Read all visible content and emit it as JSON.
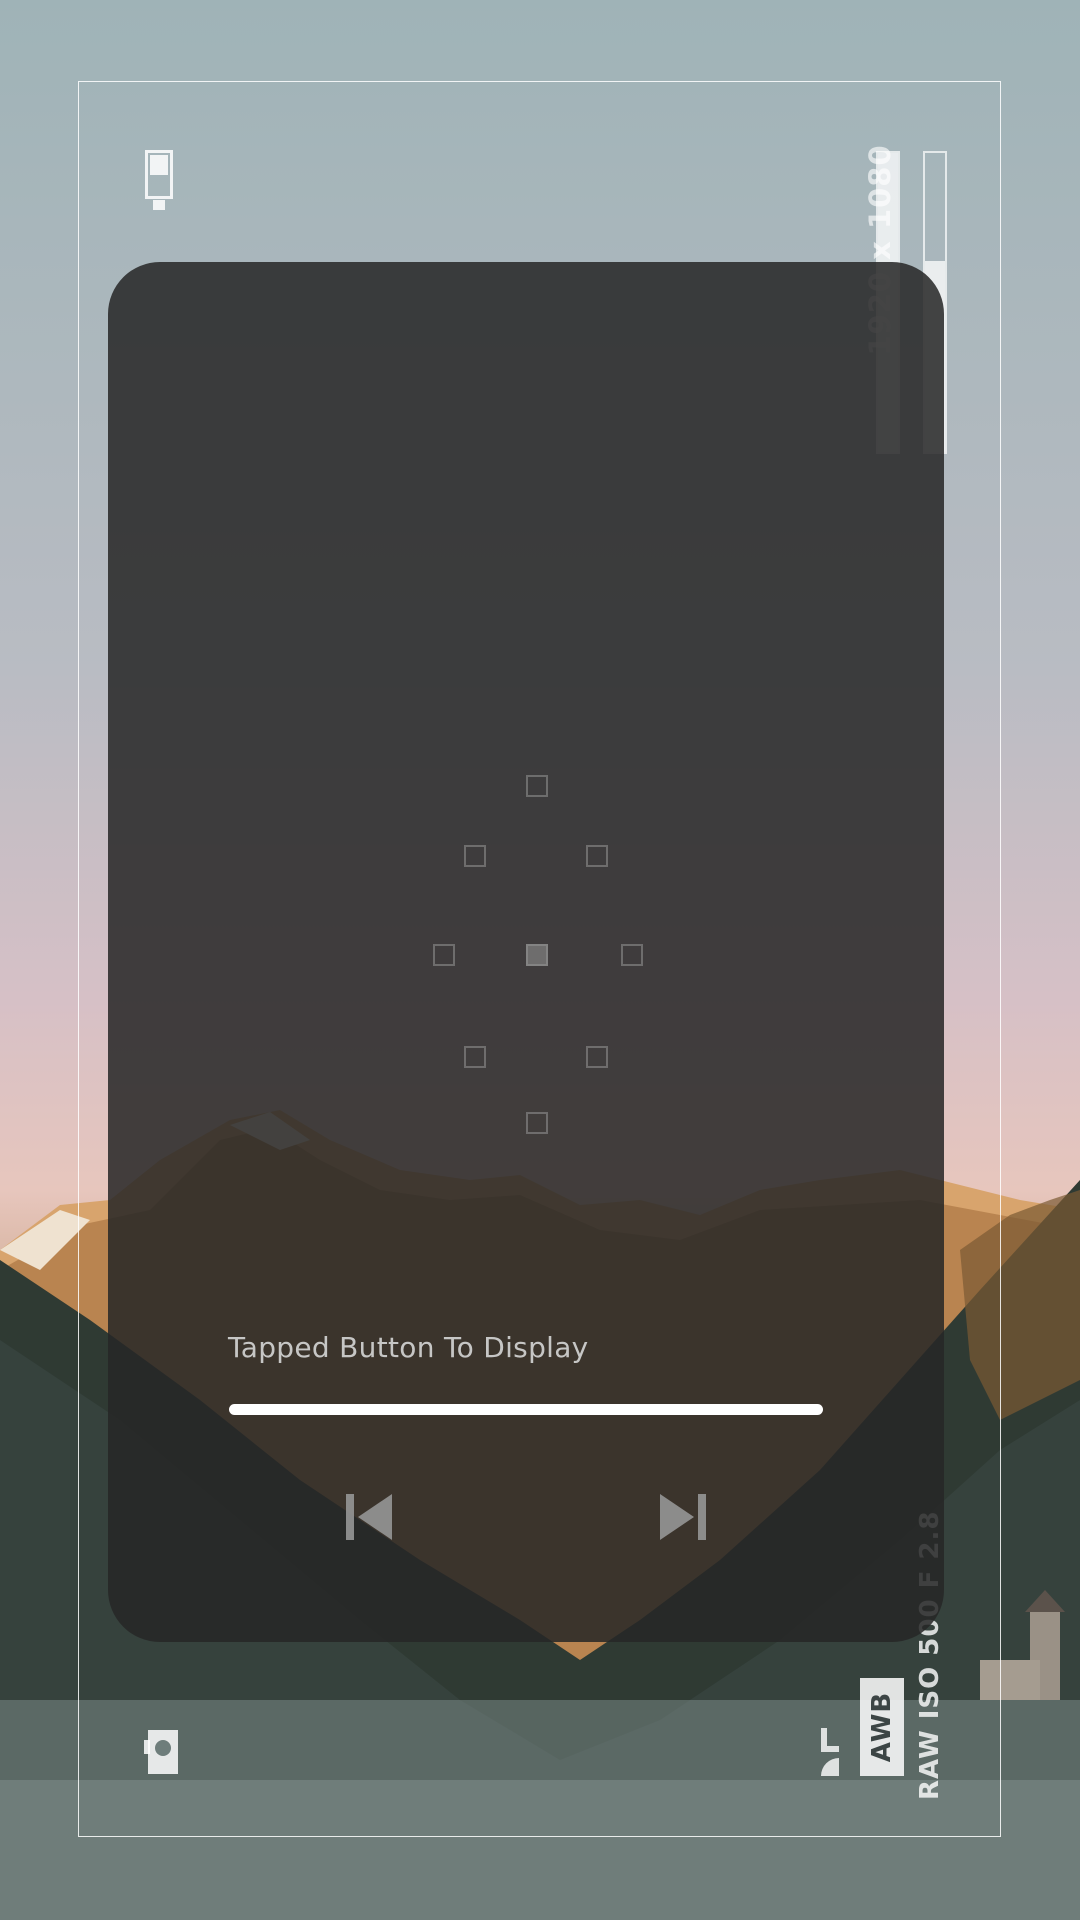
{
  "camera_hud": {
    "resolution": "1920 x 1080",
    "exposure": "RAW ISO 500 F 2.8",
    "white_balance": "AWB",
    "level_left": 1.0,
    "level_right": 0.64
  },
  "overlay": {
    "message": "Tapped Button To Display",
    "progress": 1.0
  },
  "colors": {
    "panel": "#262626",
    "accent": "#ffffff",
    "muted": "#969696"
  },
  "icons": [
    "battery-icon",
    "camera-icon",
    "rotate-lock-icon",
    "skip-previous-icon",
    "skip-next-icon"
  ]
}
